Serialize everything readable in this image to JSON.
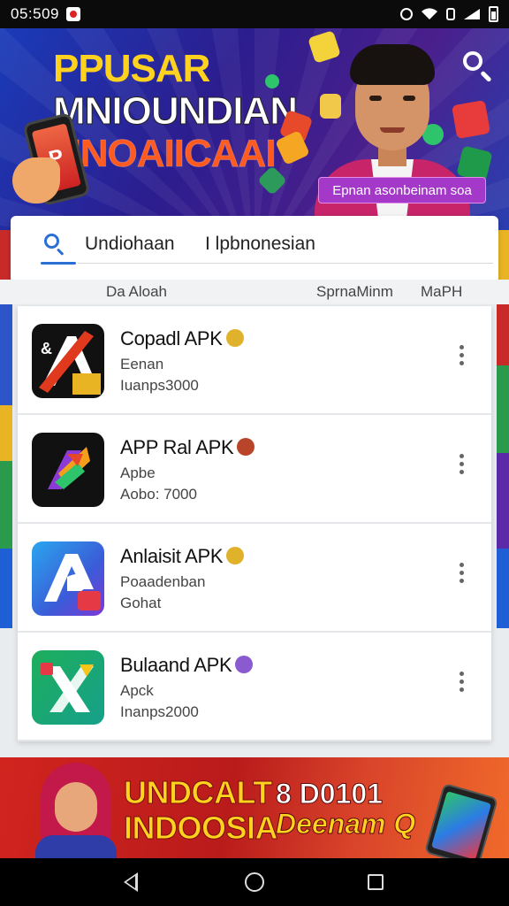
{
  "status_bar": {
    "time": "05:509",
    "icons": [
      "notification-icon",
      "alarm-icon",
      "wifi-icon",
      "vibrate-icon",
      "signal-icon",
      "battery-icon"
    ]
  },
  "hero": {
    "title_line1": "PPUSAR",
    "title_line2": "MNIOUNDIAN",
    "title_line3": "UNOAIICAAI",
    "tag": "Epnan asonbeinam soa",
    "colors": {
      "title_yellow": "#ffd21f",
      "title_orange": "#ff5a1f",
      "tag_bg": "#a438c8"
    }
  },
  "search": {
    "value": "Undiohaan",
    "chip": "I lpbnonesian",
    "accent": "#2a6fd6"
  },
  "columns": {
    "left": "Da Aloah",
    "mid": "SprnaMinm",
    "right": "MaPH"
  },
  "apps": [
    {
      "name": "Copadl APK",
      "sub": "Eenan",
      "meta": "Iuanps3000",
      "icon": "app-icon-black-red-a",
      "badge_color": "#e0b12a"
    },
    {
      "name": "APP Ral APK",
      "sub": "Apbe",
      "meta": "Aobo: 7000",
      "icon": "app-icon-black-colorful",
      "badge_color": "#b8452a"
    },
    {
      "name": "Anlaisit APK",
      "sub": "Poaadenban",
      "meta": "Gohat",
      "icon": "app-icon-blue-a",
      "badge_color": "#e0b12a"
    },
    {
      "name": "Bulaand APK",
      "sub": "Apck",
      "meta": "Inanps2000",
      "icon": "app-icon-green-x",
      "badge_color": "#8a5ad0"
    }
  ],
  "bottom_banner": {
    "title_line1": "UNDCALT",
    "title_line2": "INDOOSIA",
    "right_line1": "8 D0101",
    "right_line2": "Deenam Q"
  }
}
